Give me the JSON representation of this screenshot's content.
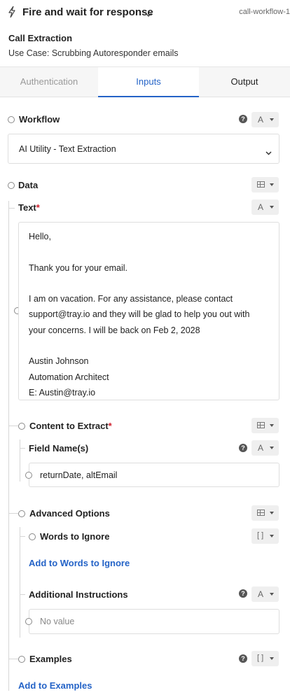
{
  "header": {
    "icon": "bolt-icon",
    "title": "Fire and wait for response",
    "id_label": "call-workflow-1",
    "subtitle": "Call Extraction",
    "description": "Use Case: Scrubbing Autoresponder emails"
  },
  "tabs": [
    {
      "label": "Authentication",
      "state": "inactive"
    },
    {
      "label": "Inputs",
      "state": "active"
    },
    {
      "label": "Output",
      "state": "inactive"
    }
  ],
  "type_glyphs": {
    "text": "A",
    "array": "[ ]"
  },
  "workflow": {
    "label": "Workflow",
    "value": "AI Utility - Text Extraction"
  },
  "data": {
    "label": "Data",
    "text": {
      "label": "Text",
      "required_mark": "*",
      "lines": [
        "Hello,",
        "",
        "Thank you for your email.",
        "",
        "I am on vacation. For any assistance, please contact",
        "support@tray.io and they will be glad to help you out with",
        "your concerns. I will be back on Feb 2, 2028",
        "",
        "Austin Johnson",
        "Automation Architect",
        "E: Austin@tray.io"
      ]
    },
    "content_to_extract": {
      "label": "Content to Extract",
      "required_mark": "*",
      "field_names": {
        "label": "Field Name(s)",
        "value": "returnDate, altEmail"
      }
    },
    "advanced_options": {
      "label": "Advanced Options",
      "words_to_ignore": {
        "label": "Words to Ignore",
        "add_link": "Add to Words to Ignore"
      },
      "additional_instructions": {
        "label": "Additional Instructions",
        "placeholder": "No value"
      }
    },
    "examples": {
      "label": "Examples",
      "add_link": "Add to Examples"
    }
  },
  "colors": {
    "accent": "#2463c7",
    "required": "#d0202e"
  }
}
